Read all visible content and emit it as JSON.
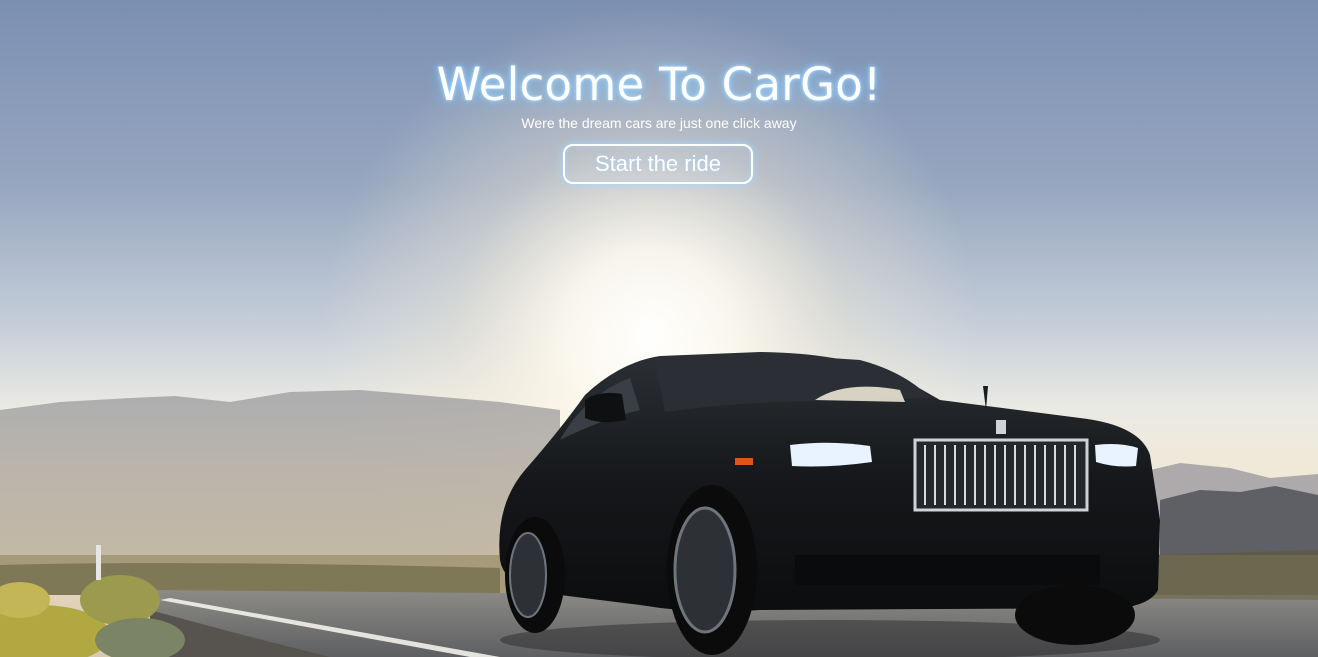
{
  "hero": {
    "title": "Welcome To CarGo!",
    "subtitle": "Were the dream cars are just one click away",
    "cta_label": "Start the ride",
    "background": "car-on-desert-road-photo"
  },
  "colors": {
    "sky_top": "#7f93b5",
    "sky_horizon": "#fdf6e4",
    "mountains": "#8a8f9a",
    "road": "#6c6f73",
    "car_body": "#131517",
    "text": "#ffffff",
    "glow": "#8fcfff"
  }
}
